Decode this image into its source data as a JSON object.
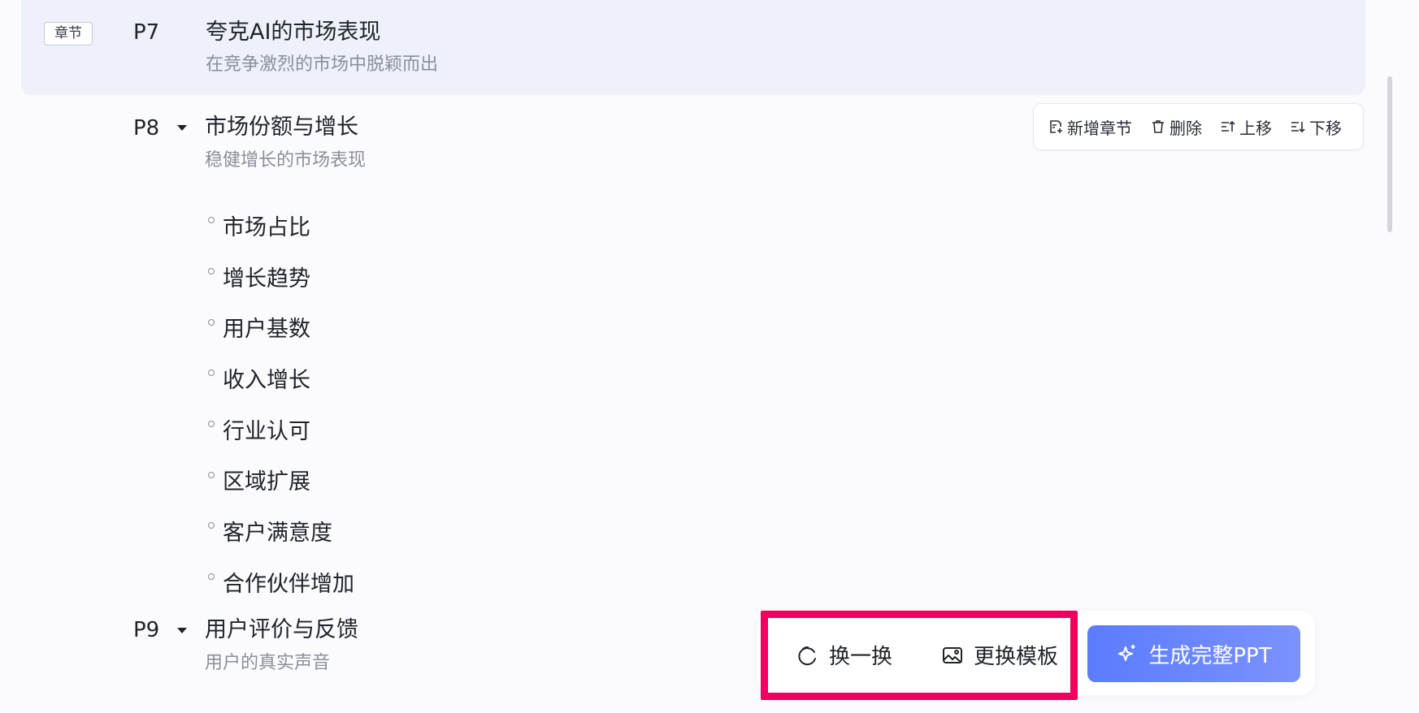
{
  "chapter": {
    "tag": "章节",
    "page": "P7",
    "title": "夸克AI的市场表现",
    "subtitle": "在竞争激烈的市场中脱颖而出"
  },
  "sections": [
    {
      "page": "P8",
      "title": "市场份额与增长",
      "subtitle": "稳健增长的市场表现",
      "bullets": [
        "市场占比",
        "增长趋势",
        "用户基数",
        "收入增长",
        "行业认可",
        "区域扩展",
        "客户满意度",
        "合作伙伴增加"
      ]
    },
    {
      "page": "P9",
      "title": "用户评价与反馈",
      "subtitle": "用户的真实声音"
    }
  ],
  "toolbar": {
    "add_chapter": "新增章节",
    "delete": "删除",
    "move_up": "上移",
    "move_down": "下移"
  },
  "actions": {
    "shuffle": "换一换",
    "change_template": "更换模板",
    "generate": "生成完整PPT"
  },
  "colors": {
    "highlight_box": "#f0005e",
    "generate_button": "#5b7cff",
    "chapter_background": "#eef0fa"
  }
}
